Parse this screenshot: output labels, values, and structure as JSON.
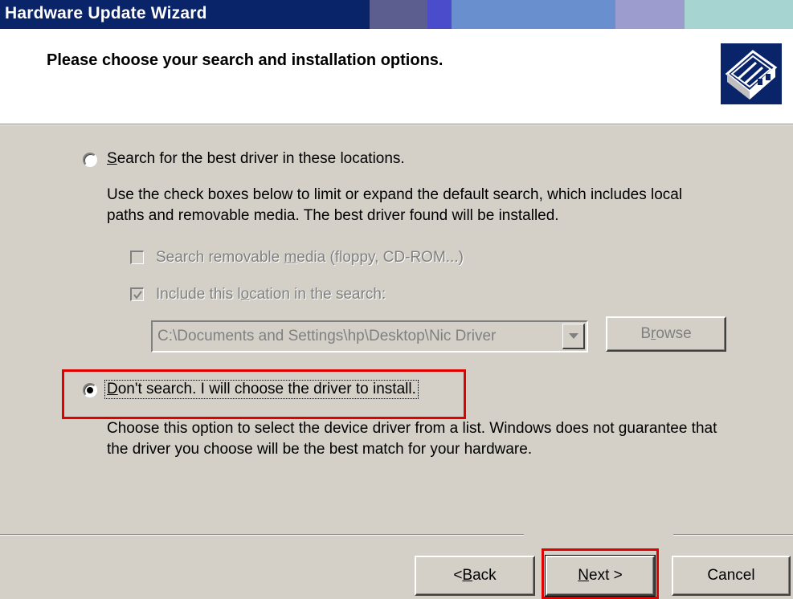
{
  "window": {
    "title": "Hardware Update Wizard"
  },
  "header": {
    "title": "Please choose your search and installation options.",
    "icon": "hardware-wizard-icon"
  },
  "option_search": {
    "label_prefix": "",
    "label_accel": "S",
    "label_rest": "earch for the best driver in these locations.",
    "selected": false,
    "description_line1": "Use the check boxes below to limit or expand the default search, which includes local",
    "description_line2": "paths and removable media. The best driver found will be installed."
  },
  "checkbox_removable": {
    "label_prefix": "Search removable ",
    "label_accel": "m",
    "label_rest": "edia (floppy, CD-ROM...)",
    "checked": false,
    "enabled": false
  },
  "checkbox_location": {
    "label_prefix": "Include this l",
    "label_accel": "o",
    "label_rest": "cation in the search:",
    "checked": true,
    "enabled": false
  },
  "location_combo": {
    "value": "C:\\Documents and Settings\\hp\\Desktop\\Nic Driver"
  },
  "browse_button": {
    "label_prefix": "B",
    "label_accel": "r",
    "label_rest": "owse"
  },
  "option_dont_search": {
    "label_accel": "D",
    "label_rest": "on't search. I will choose the driver to install.",
    "selected": true,
    "description_line1": "Choose this option to select the device driver from a list.  Windows does not guarantee that",
    "description_line2": "the driver you choose will be the best match for your hardware."
  },
  "buttons": {
    "back_prefix": "< ",
    "back_accel": "B",
    "back_rest": "ack",
    "next_accel": "N",
    "next_rest": "ext >",
    "cancel": "Cancel"
  },
  "colors": {
    "title_bar": "#0a246a",
    "dialog_face": "#d4d0c8",
    "highlight_red": "#e00000"
  }
}
